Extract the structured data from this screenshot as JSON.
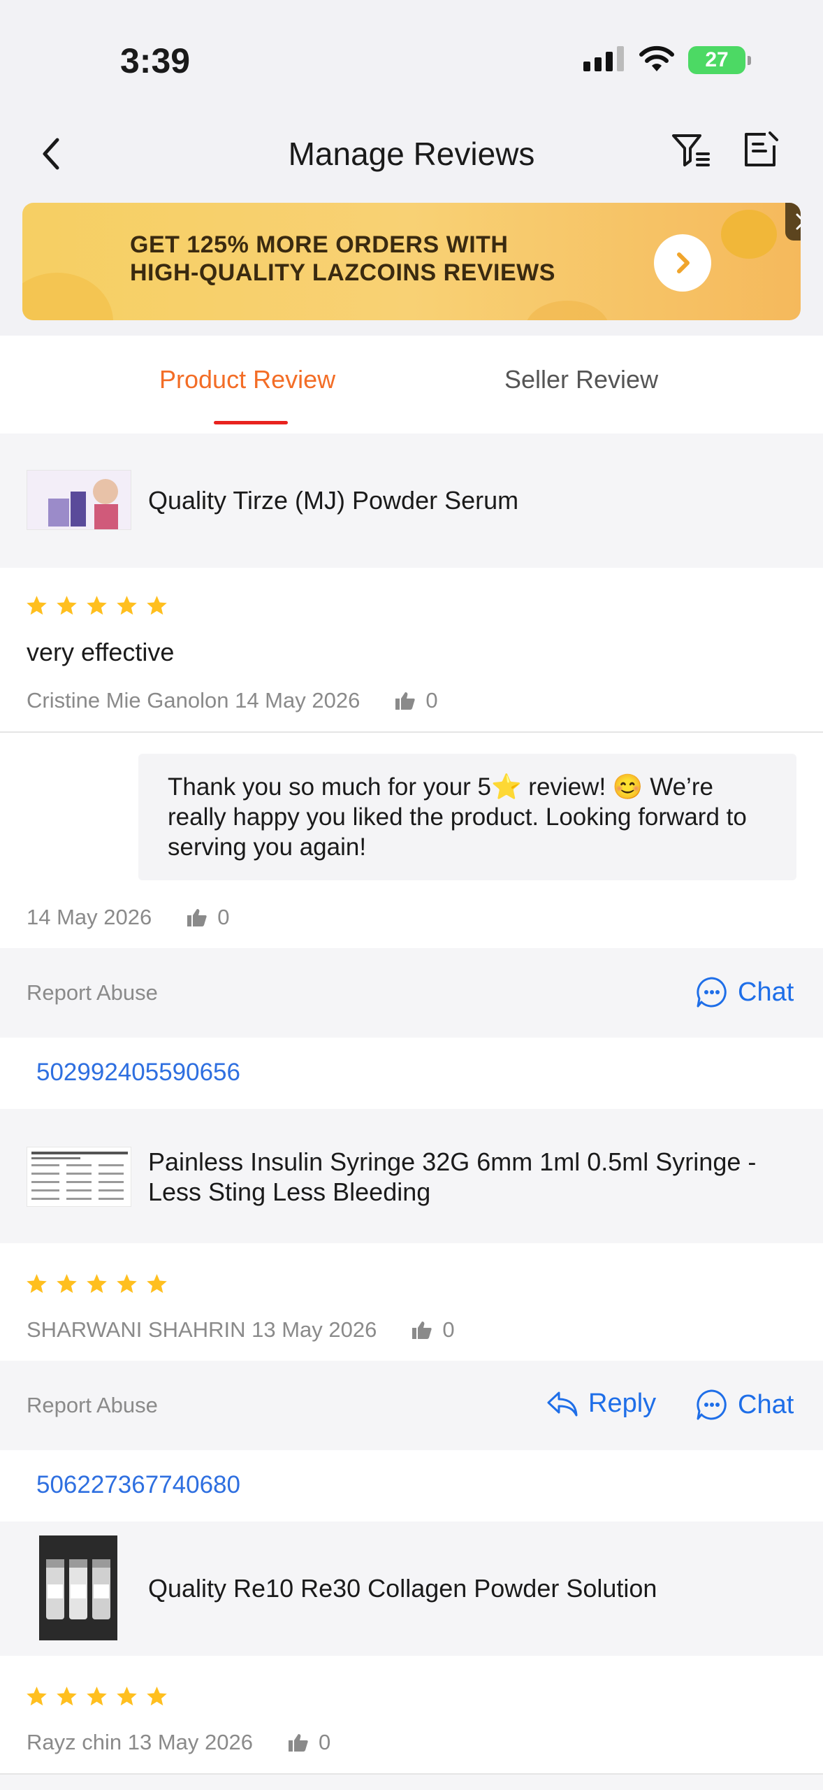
{
  "status_bar": {
    "time": "3:39",
    "battery": "27"
  },
  "header": {
    "title": "Manage Reviews"
  },
  "banner": {
    "line1": "GET 125% MORE ORDERS WITH",
    "line2": "HIGH-QUALITY LAZCOINS REVIEWS"
  },
  "tabs": [
    {
      "label": "Product Review",
      "active": true
    },
    {
      "label": "Seller Review",
      "active": false
    }
  ],
  "reviews": [
    {
      "product": "Quality Tirze (MJ)  Powder Serum",
      "rating": 5,
      "text": "very effective",
      "meta": "Cristine Mie Ganolon 14 May 2026",
      "likes": "0",
      "seller_reply": {
        "text": "Thank you so much for your 5⭐ review! 😊 We’re really happy you liked the product. Looking forward to serving you again!",
        "date": "14 May 2026",
        "likes": "0"
      },
      "report_label": "Report Abuse",
      "chat_label": "Chat",
      "order_id": "502992405590656"
    },
    {
      "product": "Painless Insulin Syringe 32G 6mm 1ml 0.5ml Syringe - Less Sting Less Bleeding",
      "rating": 5,
      "meta": "SHARWANI SHAHRIN 13 May 2026",
      "likes": "0",
      "report_label": "Report Abuse",
      "reply_label": "Reply",
      "chat_label": "Chat",
      "order_id": "506227367740680"
    },
    {
      "product": "Quality Re10 Re30 Collagen Powder Solution",
      "rating": 5,
      "meta": "Rayz chin 13 May 2026",
      "likes": "0"
    }
  ],
  "colors": {
    "accent_orange": "#f36d26",
    "tab_underline": "#e8221e",
    "link_blue": "#1e6ee8",
    "star": "#ffbf1f"
  }
}
